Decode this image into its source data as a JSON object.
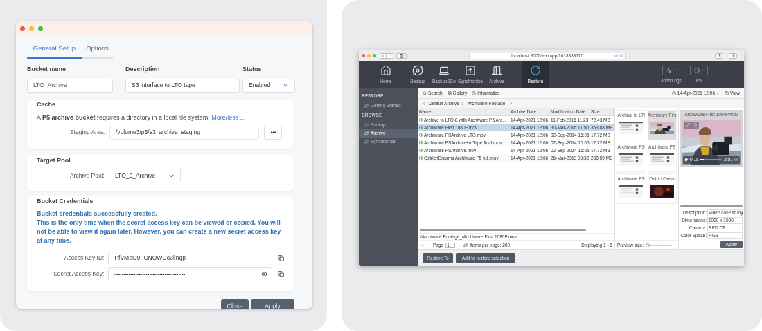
{
  "dialog": {
    "tabs": [
      {
        "label": "General Setup",
        "selected": true
      },
      {
        "label": "Options",
        "selected": false
      }
    ],
    "bucket_name": {
      "label": "Bucket name",
      "value": "LTO_Archive",
      "disabled": true
    },
    "description": {
      "label": "Description",
      "value": "S3 interface to LTO tape"
    },
    "status": {
      "label": "Status",
      "value": "Enabled"
    },
    "cache": {
      "title": "Cache",
      "note": "A **P5 archive bucket** requires a directory in a local file system.",
      "link": "More/less ...",
      "staging_label": "Staging Area:",
      "staging_value": "/volume3/p5/s3_archive_staging"
    },
    "target_pool": {
      "title": "Target Pool",
      "label": "Archive Pool:",
      "value": "LTO_9_Archive"
    },
    "credentials": {
      "title": "Bucket Credentials",
      "message": [
        "Bucket credentials successfully created.",
        "This is the only time when the secret access key can be viewed or copied. You will not be able to view it again later. However, you can create a new secret access key at any time."
      ],
      "access_key_label": "Access Key ID:",
      "access_key_value": "PfVMeO9FCNOWCo3llnqp",
      "secret_label": "Secret Access Key:",
      "secret_value": "••••••••••••••••••••••••••••••••••••••••••"
    },
    "buttons": [
      "Close",
      "Apply"
    ]
  },
  "browser": {
    "url": "localhost:8000/lexxapp/1618389116",
    "nav": [
      {
        "label": "Home",
        "selected": false
      },
      {
        "label": "Backup",
        "selected": false
      },
      {
        "label": "Backup2Go",
        "selected": false
      },
      {
        "label": "Synchronize",
        "selected": false
      },
      {
        "label": "Archive",
        "selected": false
      },
      {
        "label": "Restore",
        "selected": true
      }
    ],
    "nav_right": [
      "Jobs/Logs",
      "P5"
    ],
    "sidebar": [
      {
        "title": "RESTORE",
        "items": [
          {
            "label": "Getting Started",
            "selected": false
          }
        ]
      },
      {
        "title": "BROWSE",
        "items": [
          {
            "label": "Backup",
            "selected": false
          },
          {
            "label": "Archive",
            "selected": true
          },
          {
            "label": "Synchronize",
            "selected": false
          }
        ]
      }
    ],
    "toolbar": [
      "Search",
      "Gallery",
      "Information"
    ],
    "date": "14-Apr-2021 12:06",
    "view": "View",
    "breadcrumb": [
      "Default Archive",
      "Archiware Footage_"
    ],
    "columns": [
      "Name",
      "Archive Date",
      "Modification Date",
      "Size"
    ],
    "rows": [
      {
        "cells": [
          "Archive to LTO-8 with Archiware P5 Arc...",
          "14-Apr-2021 12:06",
          "11-Feb-2016 11:23",
          "72.43 MB"
        ],
        "selected": false
      },
      {
        "cells": [
          "Archiware First 1080P.mov",
          "14-Apr-2021 12:06",
          "30-Mar-2016 11:50",
          "353.88 MB"
        ],
        "selected": true
      },
      {
        "cells": [
          "Archiware PSArchive LTO.mov",
          "14-Apr-2021 12:06",
          "02-Sep-2014 16:05",
          "17.72 MB"
        ],
        "selected": false
      },
      {
        "cells": [
          "Archiware PSArchive+mTape final.mov",
          "14-Apr-2021 12:06",
          "02-Sep-2014 16:05",
          "17.72 MB"
        ],
        "selected": false
      },
      {
        "cells": [
          "Archiware PSArchive.mov",
          "14-Apr-2021 12:06",
          "02-Sep-2014 16:05",
          "17.72 MB"
        ],
        "selected": false
      },
      {
        "cells": [
          "OstrichDreams Archiware P5 full.mov",
          "14-Apr-2021 12:06",
          "26-Mar-2019 09:32",
          "288.59 MB"
        ],
        "selected": false
      }
    ],
    "path": "/Archiware Footage_/Archiware First 1080P.mov",
    "pager": {
      "page_label": "Page",
      "page": "1",
      "per_page": "Items per page: 200",
      "displaying": "Displaying 1 - 6"
    },
    "gallery": [
      {
        "label": "Archive to LTI",
        "kind": "screen",
        "selected": false
      },
      {
        "label": "Archiware Firs",
        "kind": "footage",
        "selected": true
      },
      {
        "label": "Archiware PS",
        "kind": "screen",
        "selected": false
      },
      {
        "label": "Archiware PS",
        "kind": "screen",
        "selected": false
      },
      {
        "label": "Archiware PS",
        "kind": "screen",
        "selected": false
      },
      {
        "label": "OstrichDrear",
        "kind": "night",
        "selected": false
      }
    ],
    "preview_size": {
      "label": "Preview size:",
      "level": 0.08
    },
    "preview": {
      "title": "Archiware First 1080P.mov",
      "elapsed": "0:18",
      "remaining": "-2:57",
      "level": 0.18
    },
    "info": [
      {
        "label": "Description:",
        "value": "Video case study"
      },
      {
        "label": "Dimensions:",
        "value": "1920 x 1080"
      },
      {
        "label": "Camera:",
        "value": "RED CF"
      },
      {
        "label": "Color Space:",
        "value": "RGB"
      }
    ],
    "apply": "Apply",
    "footer_buttons": [
      "Restore To",
      "Add to restore selection"
    ]
  }
}
